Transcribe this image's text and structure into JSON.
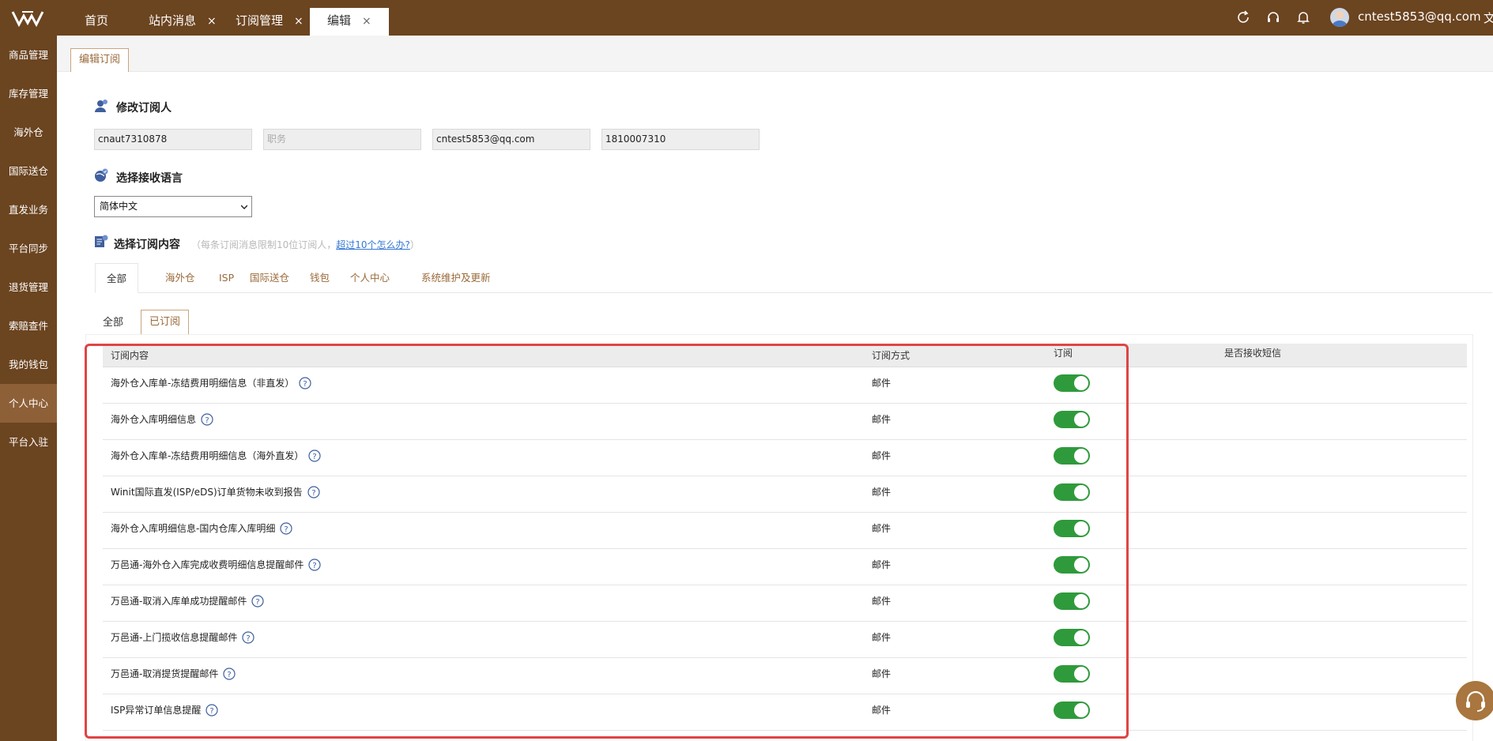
{
  "header": {
    "tabs": [
      {
        "label": "首页",
        "closable": false,
        "active": false
      },
      {
        "label": "站内消息",
        "closable": true,
        "active": false
      },
      {
        "label": "订阅管理",
        "closable": true,
        "active": false
      },
      {
        "label": "编辑",
        "closable": true,
        "active": true
      }
    ],
    "close_glyph": "×",
    "icons": [
      "refresh-icon",
      "headset-icon",
      "bell-icon"
    ],
    "user_email": "cntest5853@qq.com",
    "language_cut": "文"
  },
  "sidebar": {
    "items": [
      {
        "label": "商品管理"
      },
      {
        "label": "库存管理"
      },
      {
        "label": "海外仓"
      },
      {
        "label": "国际送仓"
      },
      {
        "label": "直发业务"
      },
      {
        "label": "平台同步"
      },
      {
        "label": "退货管理"
      },
      {
        "label": "索赔查件"
      },
      {
        "label": "我的钱包"
      },
      {
        "label": "个人中心",
        "active": true
      },
      {
        "label": "平台入驻"
      }
    ]
  },
  "page": {
    "tab_label": "编辑订阅",
    "subscriber": {
      "title": "修改订阅人",
      "fields": [
        {
          "value": "cnaut7310878",
          "placeholder": ""
        },
        {
          "value": "",
          "placeholder": "职务"
        },
        {
          "value": "cntest5853@qq.com",
          "placeholder": ""
        },
        {
          "value": "1810007310",
          "placeholder": ""
        }
      ]
    },
    "language": {
      "title": "选择接收语言",
      "selected": "简体中文"
    },
    "content": {
      "title": "选择订阅内容",
      "hint_prefix": "（每条订阅消息限制10位订阅人，",
      "hint_link": "超过10个怎么办?",
      "hint_suffix": "）",
      "category_tabs": [
        "全部",
        "海外仓",
        "ISP",
        "国际送仓",
        "钱包",
        "个人中心",
        "系统维护及更新"
      ],
      "filter_all": "全部",
      "filter_subscribed": "已订阅"
    },
    "table": {
      "headers": {
        "content": "订阅内容",
        "method": "订阅方式",
        "subscribe": "订阅",
        "sms": "是否接收短信"
      },
      "rows": [
        {
          "name": "海外仓入库单-冻结费用明细信息（非直发）",
          "method": "邮件",
          "subscribed": true
        },
        {
          "name": "海外仓入库明细信息",
          "method": "邮件",
          "subscribed": true
        },
        {
          "name": "海外仓入库单-冻结费用明细信息（海外直发）",
          "method": "邮件",
          "subscribed": true
        },
        {
          "name": "Winit国际直发(ISP/eDS)订单货物未收到报告",
          "method": "邮件",
          "subscribed": true
        },
        {
          "name": "海外仓入库明细信息-国内仓库入库明细",
          "method": "邮件",
          "subscribed": true
        },
        {
          "name": "万邑通-海外仓入库完成收费明细信息提醒邮件",
          "method": "邮件",
          "subscribed": true
        },
        {
          "name": "万邑通-取消入库单成功提醒邮件",
          "method": "邮件",
          "subscribed": true
        },
        {
          "name": "万邑通-上门揽收信息提醒邮件",
          "method": "邮件",
          "subscribed": true
        },
        {
          "name": "万邑通-取消提货提醒邮件",
          "method": "邮件",
          "subscribed": true
        },
        {
          "name": "ISP异常订单信息提醒",
          "method": "邮件",
          "subscribed": true
        }
      ]
    }
  },
  "colors": {
    "brand": "#6b4420",
    "sidebar_active": "#8e6038",
    "accent_text": "#9a6a3a",
    "toggle_on": "#2f9a3b",
    "highlight": "#e04444",
    "link": "#3478d4"
  }
}
